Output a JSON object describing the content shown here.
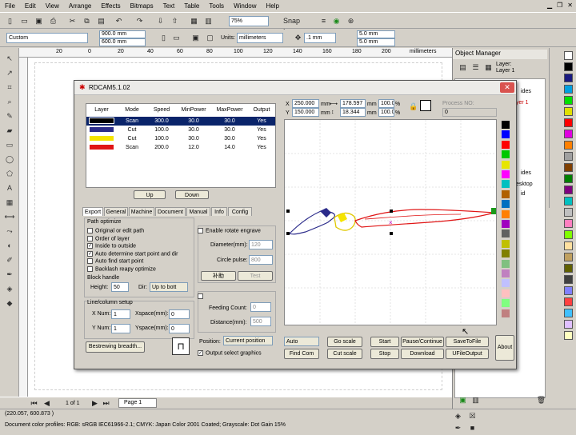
{
  "menu": [
    "File",
    "Edit",
    "View",
    "Arrange",
    "Effects",
    "Bitmaps",
    "Text",
    "Table",
    "Tools",
    "Window",
    "Help"
  ],
  "std_toolbar": {
    "zoom": "75%",
    "snap_to": "Snap to"
  },
  "prop_toolbar": {
    "page_size": "Custom",
    "width": "900.0 mm",
    "height": "600.0 mm",
    "units_label": "Units:",
    "units": "millimeters",
    "nudge": ".1 mm",
    "dup_x": "5.0 mm",
    "dup_y": "5.0 mm"
  },
  "ruler": {
    "h_ticks": [
      "20",
      "0",
      "20",
      "40",
      "60",
      "80",
      "100",
      "120",
      "140",
      "160",
      "180",
      "200",
      "220",
      "240",
      "260"
    ],
    "units": "millimeters",
    "v_ticks": [
      "300",
      "250",
      "200",
      "150",
      "100",
      "50",
      "0"
    ]
  },
  "object_manager": {
    "title": "Object Manager",
    "layer_label": "Layer:",
    "layer_value": "Layer 1",
    "items": [
      "ides",
      "yer 1",
      "ides",
      "esktop",
      "id"
    ]
  },
  "page_tabs": {
    "counter": "1 of 1",
    "page": "Page 1"
  },
  "status": {
    "coords": "(220.057, 600.873 )",
    "profile": "Document color profiles: RGB: sRGB IEC61966-2.1; CMYK: Japan Color 2001 Coated; Grayscale: Dot Gain 15%"
  },
  "dialog": {
    "title": "RDCAM5.1.02",
    "close": "✕",
    "table_headers": [
      "Layer",
      "Mode",
      "Speed",
      "MinPower",
      "MaxPower",
      "Output"
    ],
    "layers": [
      {
        "color": "#000000",
        "mode": "Scan",
        "speed": "300.0",
        "min": "30.0",
        "max": "30.0",
        "output": "Yes"
      },
      {
        "color": "#2b2b8a",
        "mode": "Cut",
        "speed": "100.0",
        "min": "30.0",
        "max": "30.0",
        "output": "Yes"
      },
      {
        "color": "#f5e400",
        "mode": "Cut",
        "speed": "100.0",
        "min": "30.0",
        "max": "30.0",
        "output": "Yes"
      },
      {
        "color": "#e01515",
        "mode": "Scan",
        "speed": "200.0",
        "min": "12.0",
        "max": "14.0",
        "output": "Yes"
      }
    ],
    "up": "Up",
    "down": "Down",
    "tabs": [
      "Export",
      "General",
      "Machine",
      "Document",
      "Manual",
      "Info",
      "Config"
    ],
    "path_optimize": "Path optimize",
    "options": [
      {
        "label": "Original or edit path",
        "checked": false
      },
      {
        "label": "Order of layer",
        "checked": false
      },
      {
        "label": "Inside to outside",
        "checked": true
      },
      {
        "label": "Auto determine start point and dir",
        "checked": true
      },
      {
        "label": "Auto find start point",
        "checked": false
      },
      {
        "label": "Backlash reapy optimize",
        "checked": false
      }
    ],
    "block_handle": "Block handle",
    "height_label": "Height:",
    "height": "50",
    "dir_label": "Dir:",
    "dir": "Up to bott",
    "linecol": "Line/column setup",
    "xnum_label": "X Num:",
    "xnum": "1",
    "xspace_label": "Xspace(mm):",
    "xspace": "0",
    "ynum_label": "Y Num:",
    "ynum": "1",
    "yspace_label": "Yspace(mm):",
    "yspace": "0",
    "bestrew": "Bestrewing breadth...",
    "rotate": "Enable rotate engrave",
    "diameter_label": "Diameter(mm):",
    "diameter": "120",
    "circle_label": "Circle pulse:",
    "circle": "800",
    "assist": "补助",
    "test": "Test",
    "feeding_label": "Feeding Count:",
    "feeding": "0",
    "distance_label": "Distance(mm):",
    "distance": "500",
    "position_label": "Position:",
    "position": "Current position",
    "output_select": "Output select graphics",
    "x_label": "X",
    "x": "250.000",
    "y_label": "Y",
    "y": "150.000",
    "mm": "mm",
    "w": "178.597",
    "h": "18.344",
    "pct1": "100.0",
    "pct2": "100.0",
    "pct": "%",
    "process_no": "Process NO:",
    "process_val": "0",
    "auto": "Auto",
    "buttons": {
      "goscale": "Go scale",
      "cutscale": "Cut scale",
      "findcom": "Find Com",
      "start": "Start",
      "stop": "Stop",
      "pause": "Pause/Continue",
      "download": "Download",
      "savetofile": "SaveToFile",
      "udfile": "UFileOutput",
      "about": "About"
    },
    "palette": [
      "#000000",
      "#0000ff",
      "#ff0000",
      "#00c800",
      "#e6e600",
      "#ff00ff",
      "#00c0c0",
      "#b06000",
      "#0070c0",
      "#ff8000",
      "#a000c0",
      "#606060",
      "#c0c000",
      "#808000",
      "#80c080",
      "#c080c0",
      "#c0c0ff",
      "#ffc0c0",
      "#80ff80",
      "#c08080"
    ]
  },
  "doc_palette": [
    "#ffffff",
    "#000000",
    "#1a1a80",
    "#00a0e0",
    "#00e000",
    "#e0e000",
    "#ff0000",
    "#e000e0",
    "#ff8000",
    "#a0a0a0",
    "#804000",
    "#008000",
    "#800080",
    "#00c0c0",
    "#c0c0c0",
    "#ff80c0",
    "#80ff00",
    "#ffe0a0",
    "#c0a060",
    "#606000",
    "#404040",
    "#8080ff",
    "#ff4040",
    "#40c0ff",
    "#e0c0ff",
    "#ffffc0"
  ],
  "colors": {
    "accent": "#0a246a"
  }
}
